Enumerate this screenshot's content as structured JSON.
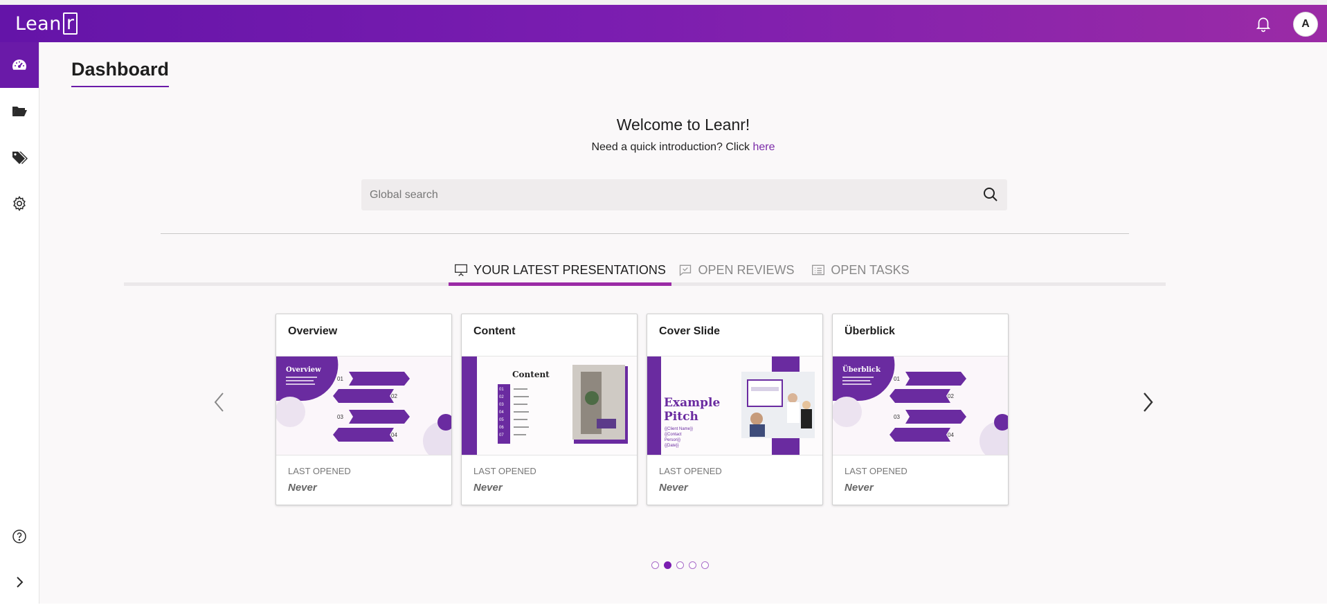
{
  "app": {
    "logo_text": "Lean",
    "logo_box": "r",
    "avatar_initial": "A",
    "accent_color": "#6a1aa8"
  },
  "sidebar": {
    "items": [
      {
        "name": "dashboard",
        "icon": "dashboard-gauge-icon",
        "active": true
      },
      {
        "name": "folders",
        "icon": "folder-open-icon",
        "active": false
      },
      {
        "name": "tags",
        "icon": "tags-icon",
        "active": false
      },
      {
        "name": "settings",
        "icon": "gear-icon",
        "active": false
      },
      {
        "name": "help",
        "icon": "help-circle-icon",
        "active": false
      },
      {
        "name": "expand",
        "icon": "chevron-right-icon",
        "active": false
      }
    ]
  },
  "page": {
    "title": "Dashboard",
    "welcome": "Welcome to Leanr!",
    "intro_text": "Need a quick introduction? Click",
    "intro_link": "here"
  },
  "search": {
    "placeholder": "Global search"
  },
  "tabs": [
    {
      "label": "YOUR LATEST PRESENTATIONS",
      "icon": "presentation-icon",
      "active": true
    },
    {
      "label": "OPEN REVIEWS",
      "icon": "review-check-icon",
      "active": false
    },
    {
      "label": "OPEN TASKS",
      "icon": "task-list-icon",
      "active": false
    }
  ],
  "cards": [
    {
      "title": "Overview",
      "last_opened_label": "LAST OPENED",
      "last_opened_value": "Never",
      "thumb": {
        "heading": "Overview",
        "nums": [
          "01",
          "02",
          "03",
          "04"
        ]
      }
    },
    {
      "title": "Content",
      "last_opened_label": "LAST OPENED",
      "last_opened_value": "Never",
      "thumb": {
        "heading": "Content",
        "nums": [
          "01",
          "02",
          "03",
          "04",
          "05",
          "06",
          "07"
        ]
      }
    },
    {
      "title": "Cover Slide",
      "last_opened_label": "LAST OPENED",
      "last_opened_value": "Never",
      "thumb": {
        "heading": "Example",
        "heading2": "Pitch",
        "sub": [
          "{{Client Name}}",
          "{{Contact",
          "Person}}",
          "{{Date}}"
        ]
      }
    },
    {
      "title": "Überblick",
      "last_opened_label": "LAST OPENED",
      "last_opened_value": "Never",
      "thumb": {
        "heading": "Überblick",
        "nums": [
          "01",
          "02",
          "03",
          "04"
        ]
      }
    }
  ],
  "carousel": {
    "pages": 5,
    "active_page": 2
  }
}
